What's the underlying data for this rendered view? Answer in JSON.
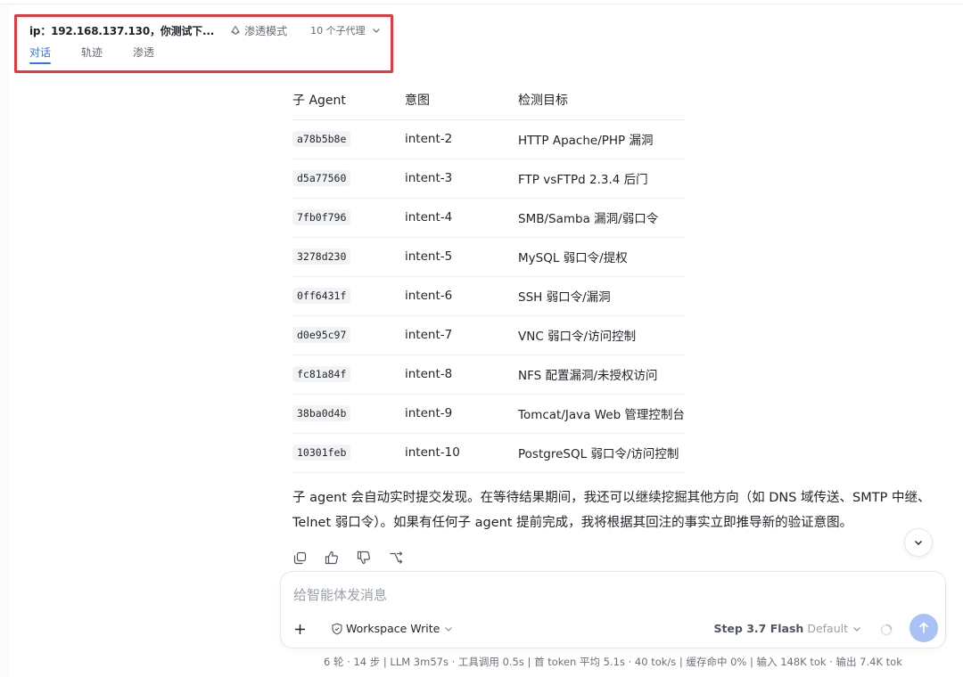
{
  "header": {
    "title": "ip：192.168.137.130，你测试下...",
    "mode_label": "渗透模式",
    "subagents_label": "10 个子代理",
    "tabs": [
      {
        "label": "对话",
        "active": true
      },
      {
        "label": "轨迹",
        "active": false
      },
      {
        "label": "渗透",
        "active": false
      }
    ]
  },
  "table": {
    "headers": [
      "子 Agent",
      "意图",
      "检测目标"
    ],
    "rows": [
      {
        "agent": "a78b5b8e",
        "intent": "intent-2",
        "target": "HTTP Apache/PHP 漏洞"
      },
      {
        "agent": "d5a77560",
        "intent": "intent-3",
        "target": "FTP vsFTPd 2.3.4 后门"
      },
      {
        "agent": "7fb0f796",
        "intent": "intent-4",
        "target": "SMB/Samba 漏洞/弱口令"
      },
      {
        "agent": "3278d230",
        "intent": "intent-5",
        "target": "MySQL 弱口令/提权"
      },
      {
        "agent": "0ff6431f",
        "intent": "intent-6",
        "target": "SSH 弱口令/漏洞"
      },
      {
        "agent": "d0e95c97",
        "intent": "intent-7",
        "target": "VNC 弱口令/访问控制"
      },
      {
        "agent": "fc81a84f",
        "intent": "intent-8",
        "target": "NFS 配置漏洞/未授权访问"
      },
      {
        "agent": "38ba0d4b",
        "intent": "intent-9",
        "target": "Tomcat/Java Web 管理控制台"
      },
      {
        "agent": "10301feb",
        "intent": "intent-10",
        "target": "PostgreSQL 弱口令/访问控制"
      }
    ]
  },
  "message": {
    "text": "子 agent 会自动实时提交发现。在等待结果期间，我还可以继续挖掘其他方向（如 DNS 域传送、SMTP 中继、Telnet 弱口令）。如果有任何子 agent 提前完成，我将根据其回注的事实立即推导新的验证意图。"
  },
  "message_actions": [
    "copy-icon",
    "thumbs-up-icon",
    "thumbs-down-icon",
    "branch-icon"
  ],
  "composer": {
    "placeholder": "给智能体发消息",
    "workspace_label": "Workspace Write",
    "model_name": "Step 3.7 Flash",
    "model_variant": "Default"
  },
  "stats": "6 轮 · 14 步 | LLM 3m57s · 工具调用 0.5s | 首 token 平均 5.1s · 40 tok/s | 缓存命中 0% | 输入 148K tok · 输出 7.4K tok",
  "colors": {
    "accent": "#3370ff",
    "highlight_border": "#e5393f",
    "send_button": "#a9c1f7"
  }
}
